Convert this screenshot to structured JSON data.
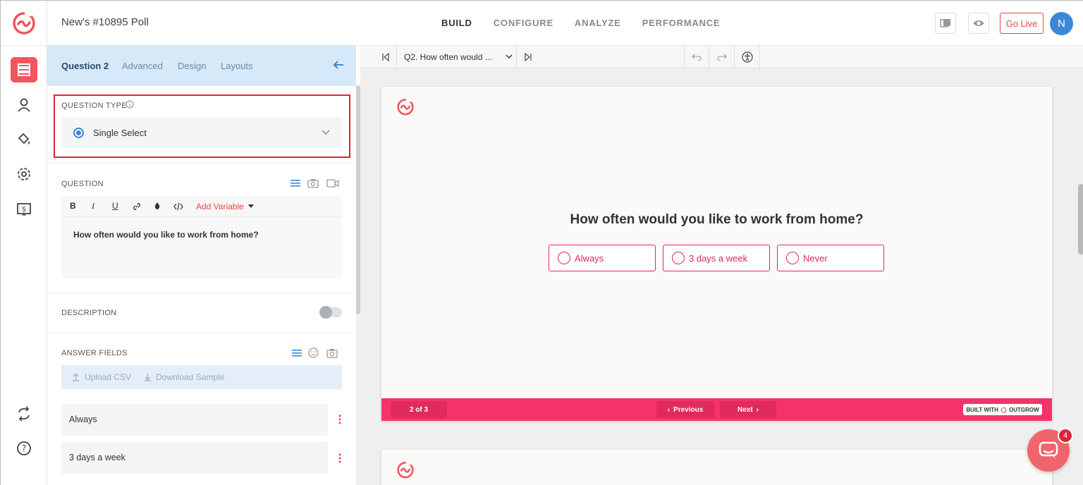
{
  "header": {
    "poll_title": "New's #10895 Poll",
    "nav": [
      "BUILD",
      "CONFIGURE",
      "ANALYZE",
      "PERFORMANCE"
    ],
    "go_live": "Go Live",
    "avatar_initial": "N"
  },
  "panel": {
    "tabs": [
      "Question 2",
      "Advanced",
      "Design",
      "Layouts"
    ],
    "question_type_label": "QUESTION TYPE",
    "question_type_value": "Single Select",
    "question_label": "QUESTION",
    "toolbar": {
      "bold": "B",
      "italic": "I",
      "underline": "U",
      "add_variable": "Add Variable"
    },
    "question_text": "How often would you like to work from home?",
    "description_label": "DESCRIPTION",
    "answer_fields_label": "ANSWER FIELDS",
    "upload_csv": "Upload CSV",
    "download_sample": "Download Sample",
    "answers": [
      "Always",
      "3 days a week"
    ]
  },
  "preview": {
    "question_select": "Q2. How often would ...",
    "card": {
      "question": "How often would you like to work from home?",
      "options": [
        "Always",
        "3 days a week",
        "Never"
      ],
      "page_indicator": "2 of 3",
      "previous": "Previous",
      "next": "Next",
      "built_with": "BUILT WITH",
      "brand": "OUTGROW"
    }
  },
  "chat": {
    "badge": "4"
  },
  "colors": {
    "accent": "#f0565d",
    "brand_pink": "#f4336a",
    "highlight_red": "#d9263d",
    "blue": "#3b88d8"
  }
}
